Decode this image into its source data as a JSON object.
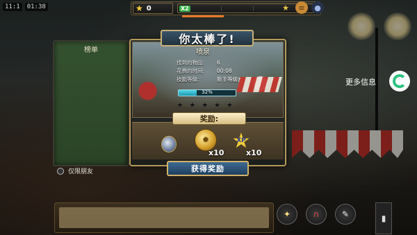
{
  "status_bar": {
    "left_text": "11:1",
    "time": "01:38"
  },
  "top_bar": {
    "stars": "0",
    "xp_multiplier": "X2"
  },
  "top_icons": [
    "star-rank-icon",
    "burger-icon",
    "potion-icon"
  ],
  "leaderboard": {
    "title": "榜单",
    "friends_only_label": "仅限朋友"
  },
  "more_info": {
    "label": "更多信息"
  },
  "dialog": {
    "title": "你太棒了!",
    "scene_name": "喷泉",
    "stats": [
      {
        "label": "找到的物品:",
        "value": "6"
      },
      {
        "label": "花费的时间:",
        "value": "00:08"
      },
      {
        "label": "技能等级:",
        "value": "新手等级"
      }
    ],
    "progress_percent": 32,
    "progress_label": "32%",
    "stars_earned": 0,
    "stars_total": 5,
    "rewards_title": "奖励:",
    "rewards": [
      {
        "name": "potion",
        "quantity": ""
      },
      {
        "name": "coin",
        "quantity": "x10"
      },
      {
        "name": "xp",
        "quantity": "x10"
      }
    ],
    "xp_badge_text": "XP",
    "collect_button": "获得奖励"
  },
  "colors": {
    "accent_gold": "#c9b27a",
    "progress": "#54d6e6",
    "button_blue": "#3e6a91",
    "leaderboard_green": "#34512f"
  }
}
